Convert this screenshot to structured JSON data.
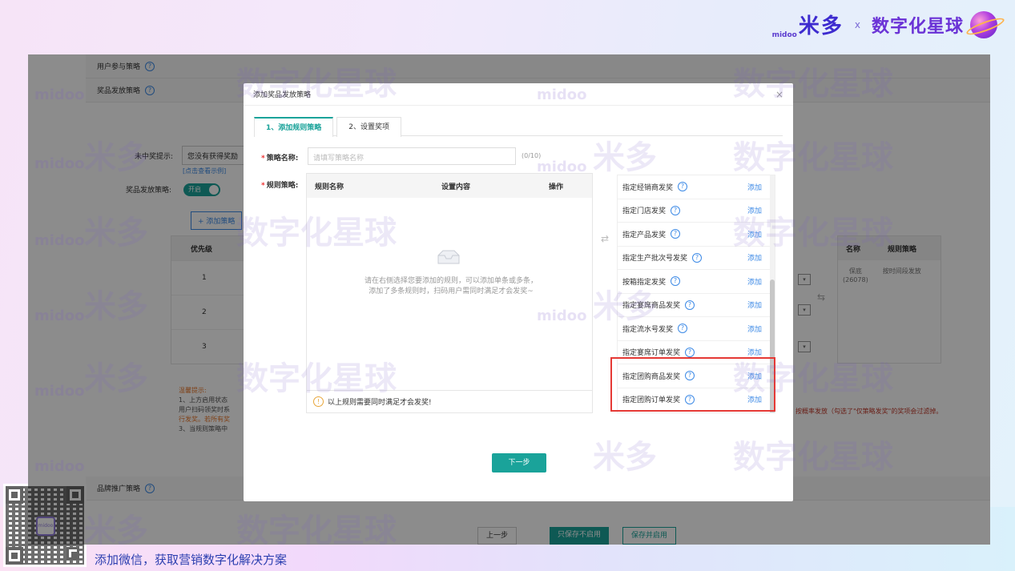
{
  "brand": {
    "logo_small": "midoo",
    "name": "米多",
    "x": "x",
    "partner": "数字化星球"
  },
  "bg_page": {
    "sections": {
      "user_strategy": "用户参与策略",
      "prize_strategy": "奖品发放策略",
      "brand_promo": "品牌推广策略"
    },
    "no_win_label": "未中奖提示:",
    "no_win_value": "您没有获得奖励",
    "example_link": "[点击查看示例]",
    "prize_label": "奖品发放策略:",
    "toggle": "开启",
    "add_strategy": "+ 添加策略",
    "table_header": "优先级",
    "rows": [
      "1",
      "2",
      "3"
    ],
    "right_headers": [
      "名称",
      "规则策略"
    ],
    "right_name": "保底",
    "right_count": "(26078)",
    "right_rule": "按时间段发放",
    "tips_title": "温馨提示:",
    "tips": [
      "1、上方启用状态",
      "用户扫码领奖时系",
      "行发奖。若所有奖",
      "3、当规则策略中"
    ],
    "tips_right": "按概率发放（勾选了\"仅策略发奖\"的奖项会过滤掉。",
    "buttons": {
      "prev": "上一步",
      "save_disabled": "只保存不启用",
      "save_enable": "保存并启用"
    }
  },
  "modal": {
    "title": "添加奖品发放策略",
    "close": "×",
    "tabs": [
      "1、添加规则策略",
      "2、设置奖项"
    ],
    "name_label": "策略名称:",
    "name_placeholder": "请填写策略名称",
    "name_counter": "(0/10)",
    "rules_label": "规则策略:",
    "rules_headers": [
      "规则名称",
      "设置内容",
      "操作"
    ],
    "empty_text_1": "请在右侧选择您要添加的规则，可以添加单条或多条，",
    "empty_text_2": "添加了多条规则时，扫码用户需同时满足才会发奖~",
    "footer_note": "以上规则需要同时满足才会发奖!",
    "options": [
      "指定经销商发奖",
      "指定门店发奖",
      "指定产品发奖",
      "指定生产批次号发奖",
      "按箱指定发奖",
      "指定宴席商品发奖",
      "指定流水号发奖",
      "指定宴席订单发奖",
      "指定团购商品发奖",
      "指定团购订单发奖"
    ],
    "add_label": "添加",
    "next": "下一步"
  },
  "watermark": {
    "midoo": "midoo",
    "mi": "米多",
    "planet": "数字化星球",
    "x": "x"
  },
  "footer": {
    "qr_center": "midoo",
    "text": "添加微信，获取营销数字化解决方案"
  }
}
